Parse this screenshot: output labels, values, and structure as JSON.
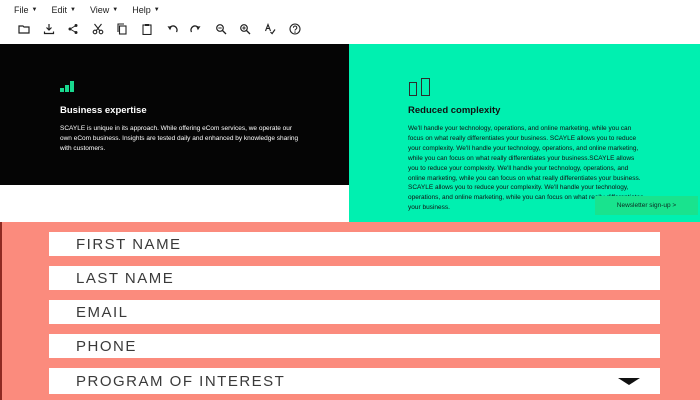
{
  "menubar": {
    "file": "File",
    "edit": "Edit",
    "view": "View",
    "help": "Help"
  },
  "toolbar": {
    "icons": [
      "folder-icon",
      "download-icon",
      "share-icon",
      "cut-icon",
      "copy-icon",
      "paste-icon",
      "undo-icon",
      "redo-icon",
      "zoom-out-icon",
      "zoom-in-icon",
      "spellcheck-icon",
      "help-icon"
    ]
  },
  "features": {
    "left": {
      "title": "Business expertise",
      "body": "SCAYLE is unique in its approach. While offering eCom services, we operate our own eCom business. Insights are tested daily and enhanced by knowledge sharing with customers.",
      "icon": "bar-chart-icon"
    },
    "right": {
      "title": "Reduced complexity",
      "body": "We'll handle your technology, operations, and online marketing, while you can focus on what really differentiates your business. SCAYLE allows you to reduce your complexity. We'll handle your technology, operations, and online marketing, while you can focus on what really differentiates your business.SCAYLE allows you to reduce your complexity. We'll handle your technology, operations, and online marketing, while you can focus on what really differentiates your business. SCAYLE allows you to reduce your complexity. We'll handle your technology, operations, and online marketing, while you can focus on what really differentiates your business.",
      "icon": "pages-icon"
    }
  },
  "newsletter": {
    "label": "Newsletter sign-up >"
  },
  "form": {
    "first_name": "FIRST NAME",
    "last_name": "LAST NAME",
    "email": "EMAIL",
    "phone": "PHONE",
    "program": "PROGRAM OF INTEREST"
  },
  "colors": {
    "left_bg": "#050505",
    "right_bg": "#00f0b0",
    "accent_green": "#19e38e",
    "form_bg": "#fb8b7d"
  }
}
